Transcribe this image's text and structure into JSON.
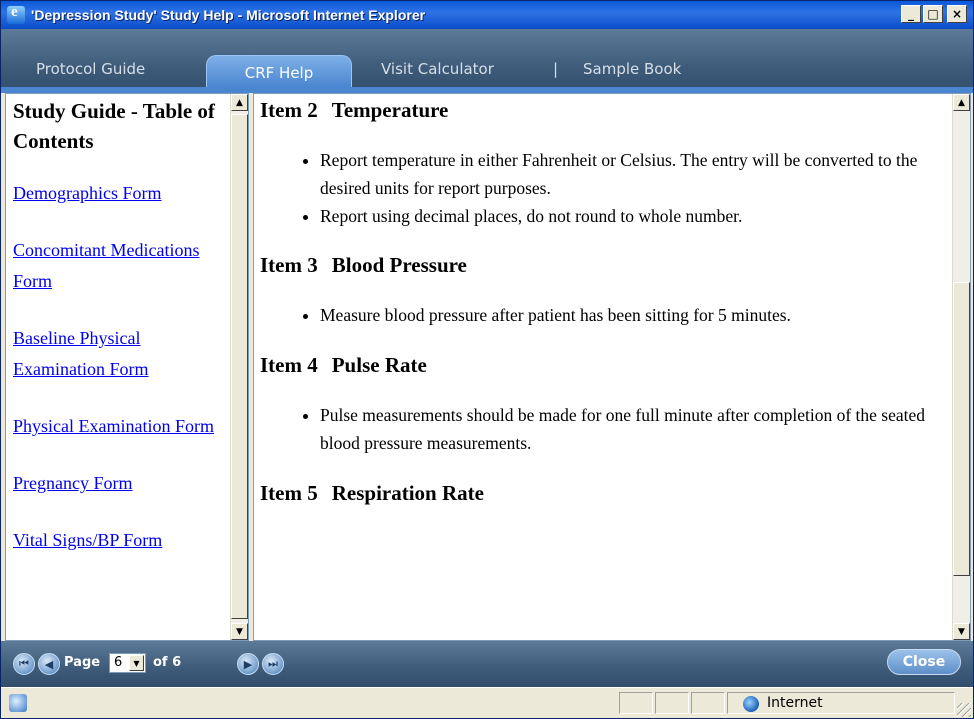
{
  "window": {
    "title": "'Depression Study' Study Help - Microsoft Internet Explorer",
    "minimize": "_",
    "maximize": "□",
    "close": "×"
  },
  "nav": {
    "protocol_guide": "Protocol Guide",
    "crf_help": "CRF Help",
    "visit_calculator": "Visit Calculator",
    "separator": "|",
    "sample_book": "Sample Book",
    "active_tab": "CRF Help"
  },
  "toc": {
    "title": "Study Guide - Table of Contents",
    "links": [
      "Demographics Form",
      "Concomitant Medications Form",
      "Baseline Physical Examination Form",
      "Physical Examination Form",
      "Pregnancy Form",
      "Vital Signs/BP Form"
    ]
  },
  "content": {
    "items": [
      {
        "number": "Item 2",
        "heading": "Temperature",
        "bullets": [
          "Report temperature in either Fahrenheit or Celsius. The entry will be converted to the desired units for report purposes.",
          "Report using decimal places, do not round to whole number."
        ]
      },
      {
        "number": "Item 3",
        "heading": "Blood Pressure",
        "bullets": [
          "Measure blood pressure after patient has been sitting for 5 minutes."
        ]
      },
      {
        "number": "Item 4",
        "heading": "Pulse Rate",
        "bullets": [
          "Pulse measurements should be made for one full minute after completion of the seated blood pressure measurements."
        ]
      },
      {
        "number": "Item 5",
        "heading": "Respiration Rate",
        "bullets": []
      }
    ]
  },
  "pager": {
    "page_label": "Page",
    "current_page": "6",
    "of_label": "of 6",
    "close_label": "Close"
  },
  "status": {
    "zone": "Internet"
  },
  "icons": {
    "first": "first-page-icon",
    "prev": "previous-page-icon",
    "next": "next-page-icon",
    "last": "last-page-icon"
  }
}
